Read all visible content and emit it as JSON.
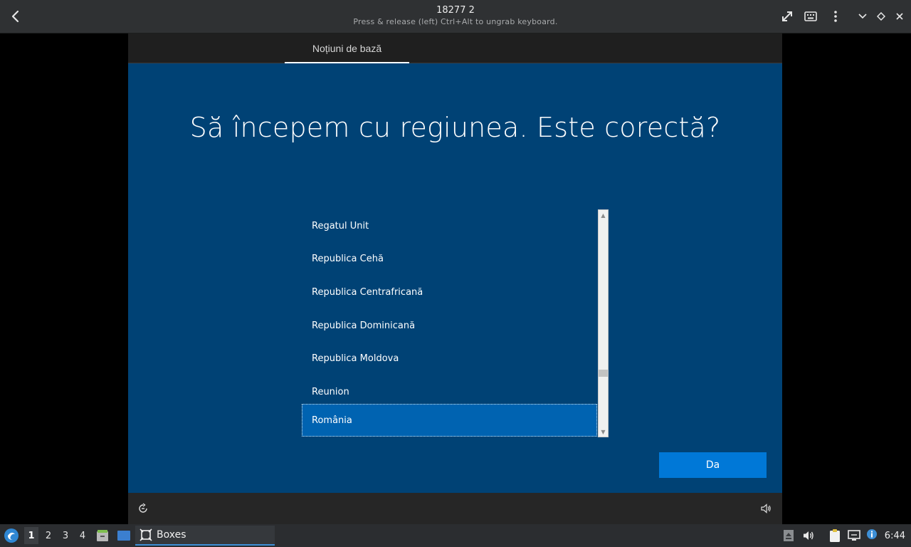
{
  "header": {
    "title": "18277 2",
    "subtitle": "Press & release (left) Ctrl+Alt to ungrab keyboard."
  },
  "oobe": {
    "tab_label": "Noțiuni de bază",
    "heading": "Să începem cu regiunea. Este corectă?",
    "regions": [
      "Regatul Unit",
      "Republica Cehă",
      "Republica Centrafricană",
      "Republica Dominicană",
      "Republica Moldova",
      "Reunion",
      "România"
    ],
    "selected_region": "România",
    "confirm_label": "Da",
    "colors": {
      "background": "#004275",
      "accent": "#0078d7",
      "selected": "#0063b1"
    }
  },
  "taskbar": {
    "workspaces": [
      "1",
      "2",
      "3",
      "4"
    ],
    "active_workspace": "1",
    "task_label": "Boxes",
    "clock": "6:44"
  }
}
